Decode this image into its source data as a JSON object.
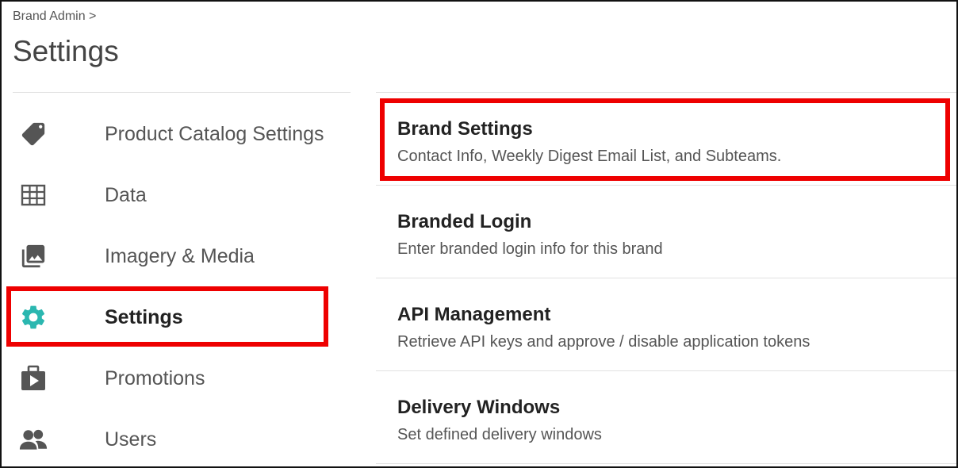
{
  "header": {
    "breadcrumb": "Brand Admin >",
    "title": "Settings"
  },
  "sidebar": {
    "items": [
      {
        "label": "Product Catalog Settings",
        "icon": "tag-icon"
      },
      {
        "label": "Data",
        "icon": "table-icon"
      },
      {
        "label": "Imagery & Media",
        "icon": "photo-library-icon"
      },
      {
        "label": "Settings",
        "icon": "gear-icon",
        "active": true
      },
      {
        "label": "Promotions",
        "icon": "briefcase-play-icon"
      },
      {
        "label": "Users",
        "icon": "users-icon"
      }
    ]
  },
  "settings": {
    "items": [
      {
        "title": "Brand Settings",
        "description": "Contact Info, Weekly Digest Email List, and Subteams."
      },
      {
        "title": "Branded Login",
        "description": "Enter branded login info for this brand"
      },
      {
        "title": "API Management",
        "description": "Retrieve API keys and approve / disable application tokens"
      },
      {
        "title": "Delivery Windows",
        "description": "Set defined delivery windows"
      }
    ]
  },
  "colors": {
    "highlight": "#ee0000",
    "active_icon": "#2bb7b0",
    "icon": "#555555",
    "text_dark": "#222222",
    "text_muted": "#555555"
  }
}
